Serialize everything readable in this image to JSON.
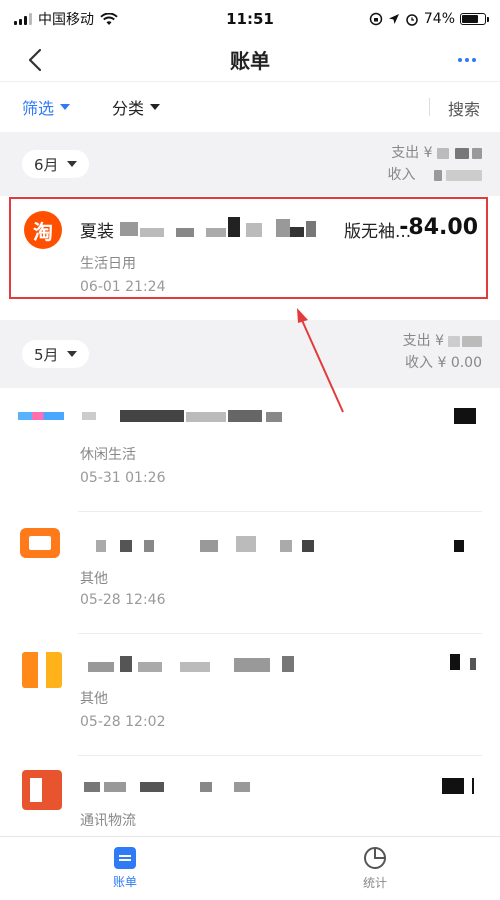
{
  "status_bar": {
    "carrier": "中国移动",
    "time": "11:51",
    "battery": "74%",
    "battery_level": 0.74
  },
  "nav": {
    "title": "账单",
    "back_icon": "chevron-left-icon",
    "more_icon": "more-icon"
  },
  "filters": {
    "filter_label": "筛选",
    "category_label": "分类",
    "search_label": "搜索"
  },
  "sections": [
    {
      "month": "6月",
      "expense_label": "支出 ¥",
      "income_label": "收入",
      "transactions": [
        {
          "title_start": "夏装",
          "title_end": "版无袖...",
          "amount": "-84.00",
          "category": "生活日用",
          "time": "06-01  21:24",
          "icon": "taobao-icon",
          "icon_text": "淘"
        }
      ]
    },
    {
      "month": "5月",
      "expense_label": "支出 ¥",
      "income_label": "收入 ¥ 0.00",
      "transactions": [
        {
          "category": "休闲生活",
          "time": "05-31  01:26"
        },
        {
          "category": "其他",
          "time": "05-28  12:46"
        },
        {
          "category": "其他",
          "time": "05-28  12:02"
        },
        {
          "category": "通讯物流",
          "time": ""
        }
      ]
    }
  ],
  "tabs": [
    {
      "label": "账单",
      "icon": "bill-icon",
      "active": true
    },
    {
      "label": "统计",
      "icon": "pie-chart-icon",
      "active": false
    }
  ],
  "colors": {
    "accent": "#2f7bf5",
    "highlight": "#e33b3b",
    "taobao": "#ff5000"
  }
}
